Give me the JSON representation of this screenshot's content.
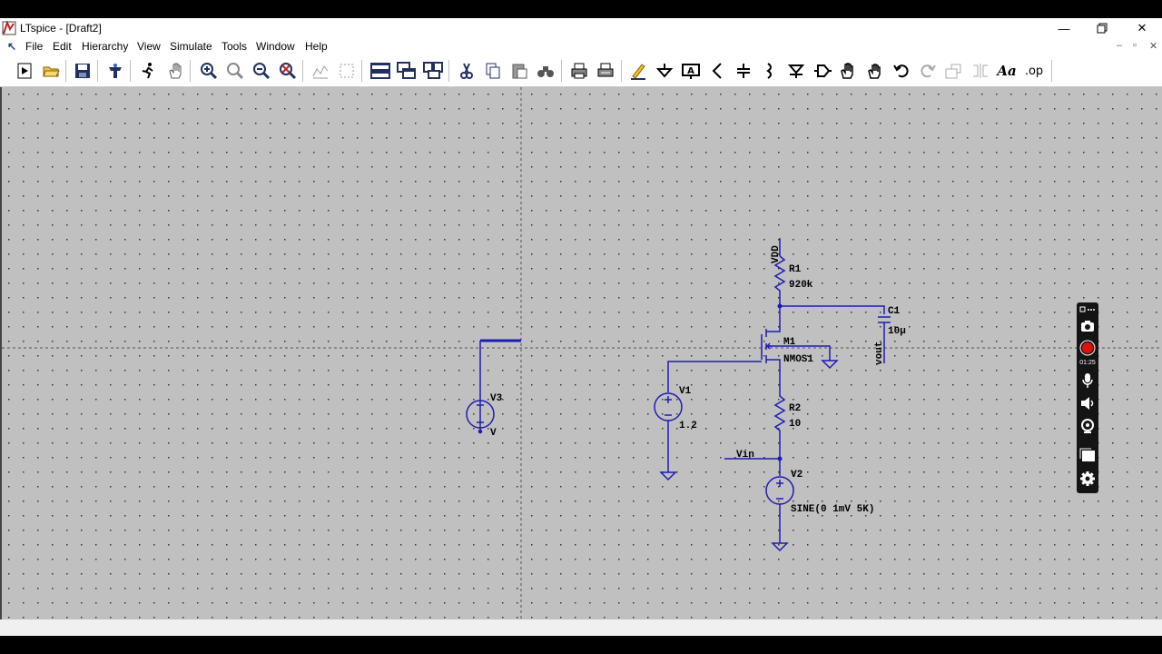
{
  "window": {
    "title": "LTspice - [Draft2]"
  },
  "menu": {
    "items": [
      "File",
      "Edit",
      "Hierarchy",
      "View",
      "Simulate",
      "Tools",
      "Window",
      "Help"
    ]
  },
  "toolbar": {
    "tools": [
      "new-schematic-icon",
      "open-folder-icon",
      "save-icon",
      "control-panel-icon",
      "run-icon",
      "pan-hand-icon",
      "zoom-in-icon",
      "zoom-area-icon",
      "zoom-out-icon",
      "zoom-fit-icon",
      "autorange-icon",
      "grid-icon",
      "tile-horizontal-icon",
      "cascade-icon",
      "tile-vertical-icon",
      "cut-icon",
      "copy-icon",
      "paste-icon",
      "find-icon",
      "print-icon",
      "print-setup-icon",
      "draw-wire-icon",
      "ground-icon",
      "label-net-icon",
      "resistor-icon",
      "capacitor-icon",
      "inductor-icon",
      "diode-icon",
      "component-icon",
      "move-icon",
      "drag-icon",
      "undo-icon",
      "redo-icon",
      "rotate-icon",
      "mirror-icon",
      "text-icon",
      "spice-directive-icon"
    ],
    "spice_directive_label": ".op",
    "text_label": "Aa"
  },
  "schematic": {
    "components": {
      "R1": {
        "name": "R1",
        "value": "920k"
      },
      "M1": {
        "name": "M1",
        "value": "NMOS1"
      },
      "R2": {
        "name": "R2",
        "value": "10"
      },
      "C1": {
        "name": "C1",
        "value": "10µ"
      },
      "V1": {
        "name": "V1",
        "value": "1.2"
      },
      "V2": {
        "name": "V2",
        "value": "SINE(0 1mV 5K)"
      },
      "V3": {
        "name": "V3",
        "value": "V"
      }
    },
    "nets": {
      "vdd": "VDD",
      "vin": "Vin",
      "vout": "vout"
    }
  },
  "recorder": {
    "elapsed": "01:25",
    "buttons": [
      "more-options-icon",
      "camera-icon",
      "record-icon",
      "microphone-icon",
      "speaker-icon",
      "webcam-icon",
      "window-capture-icon",
      "settings-icon"
    ]
  },
  "colors": {
    "wire": "#1c1cb4",
    "component": "#1c1cb4",
    "canvas": "#c0c0c0",
    "record": "#e01010"
  }
}
